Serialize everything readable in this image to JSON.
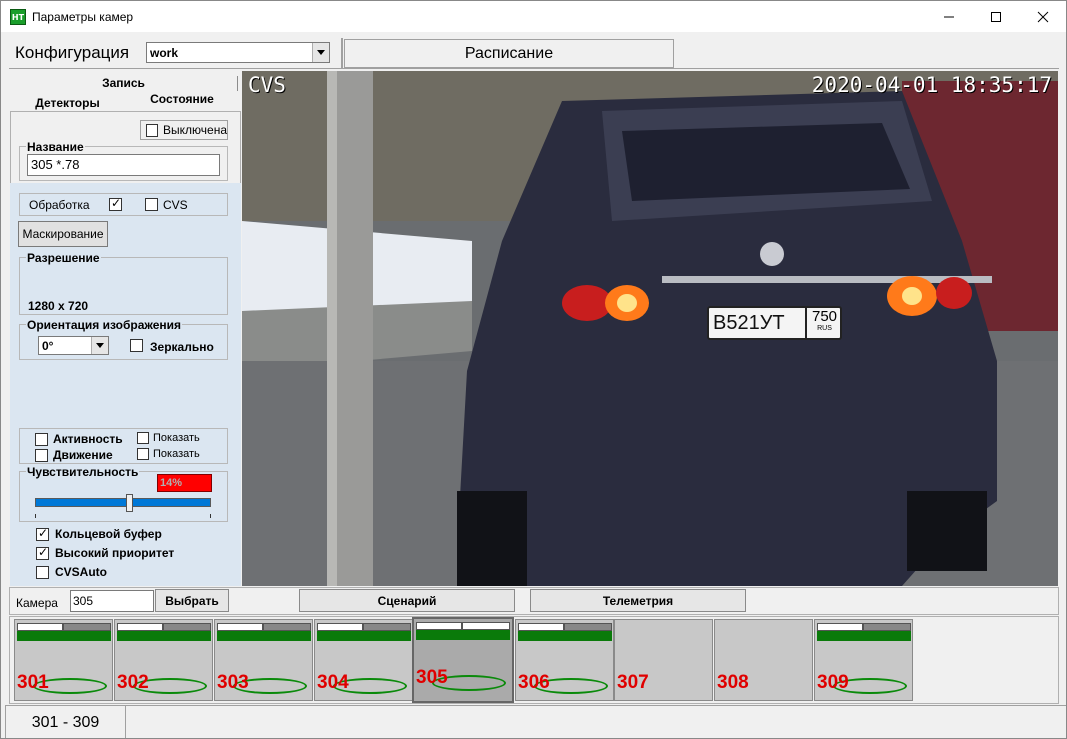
{
  "window": {
    "title": "Параметры камер",
    "icon_text": "НТ"
  },
  "top": {
    "config_label": "Конфигурация",
    "config_value": "work",
    "schedule_tab": "Расписание"
  },
  "left_tabs": {
    "record": "Запись",
    "detectors": "Детекторы",
    "state": "Состояние"
  },
  "state_panel": {
    "disabled_label": "Выключена",
    "disabled_checked": false,
    "name_title": "Название",
    "name_value": "305 *.78",
    "processing_label": "Обработка",
    "processing_checked": true,
    "cvs_label": "CVS",
    "cvs_checked": false,
    "mask_button": "Маскирование",
    "resolution_title": "Разрешение",
    "resolution_value": "1280 x 720",
    "orientation_title": "Ориентация изображения",
    "orientation_value": "0°",
    "mirror_label": "Зеркально",
    "mirror_checked": false,
    "activity_label": "Активность",
    "motion_label": "Движение",
    "show_label_1": "Показать",
    "show_label_2": "Показать",
    "sensitivity_title": "Чувствительность",
    "sensitivity_value": "14%",
    "sensitivity_slider_fraction": 0.6,
    "ring_buffer_label": "Кольцевой буфер",
    "ring_buffer_checked": true,
    "high_priority_label": "Высокий приоритет",
    "high_priority_checked": true,
    "cvsauto_label": "CVSAuto",
    "cvsauto_checked": false
  },
  "video": {
    "osd_left": "CVS",
    "osd_timestamp": "2020-04-01 18:35:17",
    "plate_main": "В521УТ",
    "plate_region": "750",
    "plate_country": "RUS"
  },
  "bottom": {
    "camera_label": "Камера",
    "camera_value": "305",
    "select_button": "Выбрать",
    "scenario_button": "Сценарий",
    "telemetry_button": "Телеметрия"
  },
  "cameras": [
    {
      "num": "301",
      "active": true
    },
    {
      "num": "302",
      "active": true
    },
    {
      "num": "303",
      "active": true
    },
    {
      "num": "304",
      "active": true
    },
    {
      "num": "305",
      "active": true,
      "selected": true
    },
    {
      "num": "306",
      "active": true
    },
    {
      "num": "307",
      "active": false
    },
    {
      "num": "308",
      "active": false
    },
    {
      "num": "309",
      "active": true
    }
  ],
  "page_tab": "301 - 309",
  "colors": {
    "accent_blue": "#0078d7",
    "status_green": "#0a7a0a",
    "alert_red": "#ff0000",
    "camera_number": "#e00000"
  }
}
